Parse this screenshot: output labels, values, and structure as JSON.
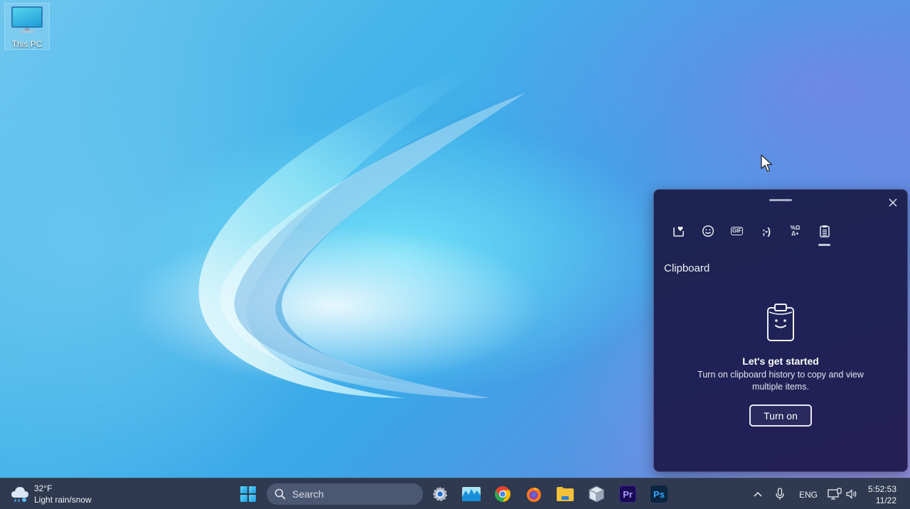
{
  "desktop": {
    "icons": [
      {
        "label": "This PC",
        "icon": "computer-monitor-icon"
      }
    ]
  },
  "emoji_panel": {
    "tabs": [
      {
        "name": "favorites",
        "icon": "heart-square-icon",
        "active": false
      },
      {
        "name": "emoji",
        "icon": "smiley-icon",
        "active": false
      },
      {
        "name": "gif",
        "icon": "gif-icon",
        "label": "GIF",
        "active": false
      },
      {
        "name": "kaomoji",
        "icon": "kaomoji-icon",
        "label": ";-)",
        "active": false
      },
      {
        "name": "symbols",
        "icon": "symbols-icon",
        "label_top": "%Ω",
        "label_bottom": "Δ+",
        "active": false
      },
      {
        "name": "clipboard",
        "icon": "clipboard-icon",
        "active": true
      }
    ],
    "section_title": "Clipboard",
    "empty_state": {
      "heading": "Let's get started",
      "description": "Turn on clipboard history to copy and view multiple items.",
      "button_label": "Turn on"
    },
    "close_icon": "close-icon"
  },
  "taskbar": {
    "weather": {
      "temperature": "32°F",
      "condition": "Light rain/snow"
    },
    "search": {
      "placeholder": "Search"
    },
    "pinned_apps": [
      {
        "name": "Settings",
        "icon": "settings-gear-icon"
      },
      {
        "name": "Photos",
        "icon": "photos-icon"
      },
      {
        "name": "Google Chrome",
        "icon": "chrome-icon"
      },
      {
        "name": "Firefox",
        "icon": "firefox-icon"
      },
      {
        "name": "File Explorer",
        "icon": "folder-icon"
      },
      {
        "name": "VirtualBox",
        "icon": "virtualbox-icon"
      },
      {
        "name": "Premiere Pro",
        "icon": "premiere-pro-icon",
        "label": "Pr"
      },
      {
        "name": "Photoshop",
        "icon": "photoshop-icon",
        "label": "Ps"
      }
    ],
    "tray": {
      "language": "ENG",
      "time": "5:52:53",
      "date": "11/22"
    }
  },
  "colors": {
    "panel_bg": "#1f2257",
    "taskbar_bg": "#2f3a50",
    "start_accent": "#1b9ee2"
  }
}
